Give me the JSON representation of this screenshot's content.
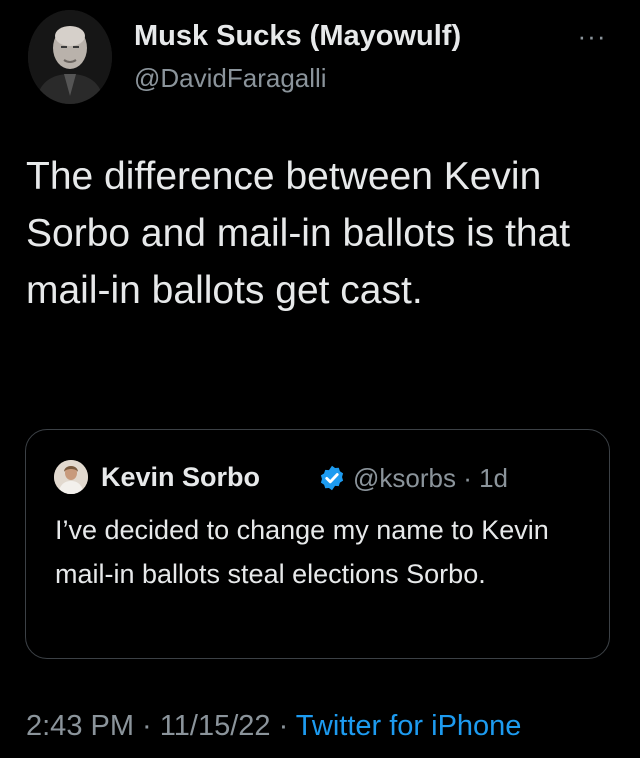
{
  "author": {
    "display_name": "Musk Sucks (Mayowulf)",
    "handle": "@DavidFaragalli"
  },
  "more_icon": "more-options-icon",
  "tweet_text": "The difference between Kevin Sorbo and mail-in ballots is that mail-in ballots get cast.",
  "quoted_tweet": {
    "display_name": "Kevin Sorbo",
    "verified": true,
    "verified_color": "#1d9bf0",
    "handle_time": "@ksorbs · 1d",
    "text": "I’ve decided to change my name to Kevin mail-in ballots steal elections Sorbo."
  },
  "footer": {
    "time": "2:43 PM",
    "separator_1": " · ",
    "date": "11/15/22",
    "separator_2": " · ",
    "source": "Twitter for iPhone"
  },
  "colors": {
    "background": "#000000",
    "primary_text": "#e7e9ea",
    "secondary_text": "#8b949b",
    "link": "#1d9bf0",
    "border": "#3c4146"
  }
}
